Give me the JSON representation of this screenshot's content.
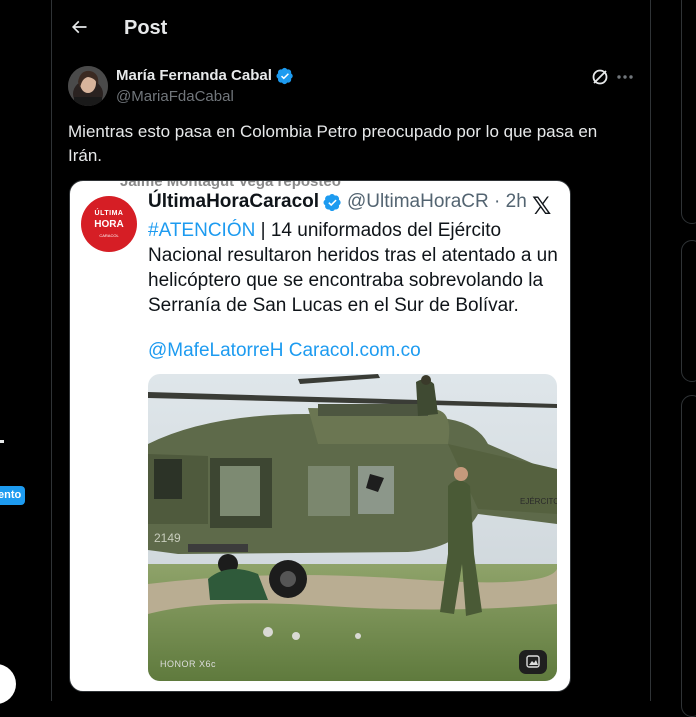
{
  "header": {
    "title": "Post",
    "back_label": "Back"
  },
  "left_sidebar": {
    "badge_text": "ento"
  },
  "post": {
    "author_name": "María Fernanda Cabal",
    "author_handle": "@MariaFdaCabal",
    "text": "Mientras esto pasa en Colombia Petro preocupado por lo que pasa en Irán."
  },
  "embedded": {
    "cut_header": "Jaime Montagut Vega reposteó",
    "logo_line1": "ÚLTIMA",
    "logo_line2": "HORA",
    "logo_line3": "CARACOL",
    "name": "ÚltimaHoraCaracol",
    "handle_time": "@UltimaHoraCR · 2h",
    "x_glyph": "𝕏",
    "hashtag": "#ATENCIÓN",
    "text": " | 14 uniformados del Ejército Nacional resultaron heridos tras el atentado a un helicóptero que se encontraba sobrevolando la Serranía de San Lucas en el Sur de Bolívar.",
    "links": "@MafeLatorreH Caracol.com.co",
    "photo_watermark": "HONOR X6c",
    "heli_number": "2149",
    "heli_label": "EJÉRCITO"
  },
  "colors": {
    "accent": "#1d9bf0",
    "background": "#000000",
    "alert_red": "#d61e25"
  }
}
